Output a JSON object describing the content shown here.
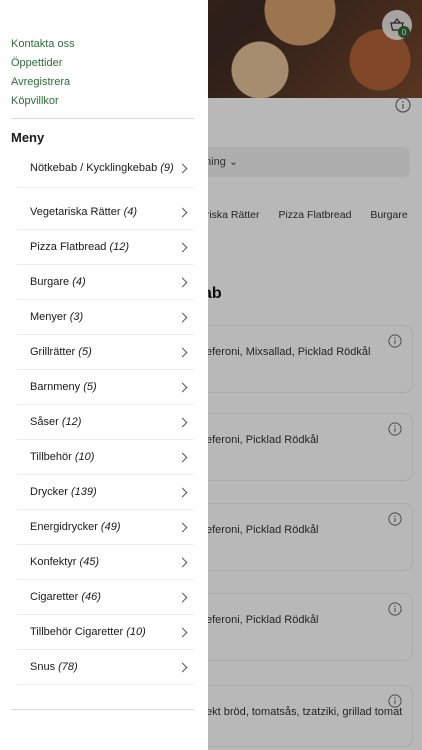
{
  "drawer": {
    "links": [
      "Kontakta oss",
      "Öppettider",
      "Avregistrera",
      "Köpvillkor"
    ],
    "menu_title": "Meny",
    "menu_items": [
      {
        "name": "Nötkebab / Kycklingkebab",
        "count": "(9)"
      },
      {
        "name": "Vegetariska Rätter",
        "count": "(4)"
      },
      {
        "name": "Pizza Flatbread",
        "count": "(12)"
      },
      {
        "name": "Burgare",
        "count": "(4)"
      },
      {
        "name": "Menyer",
        "count": "(3)"
      },
      {
        "name": "Grillrätter",
        "count": "(5)"
      },
      {
        "name": "Barnmeny",
        "count": "(5)"
      },
      {
        "name": "Såser",
        "count": "(12)"
      },
      {
        "name": "Tillbehör",
        "count": "(10)"
      },
      {
        "name": "Drycker",
        "count": "(139)"
      },
      {
        "name": "Energidrycker",
        "count": "(49)"
      },
      {
        "name": "Konfektyr",
        "count": "(45)"
      },
      {
        "name": "Cigaretter",
        "count": "(46)"
      },
      {
        "name": "Tillbehör Cigaretter",
        "count": "(10)"
      },
      {
        "name": "Snus",
        "count": "(78)"
      }
    ]
  },
  "background": {
    "cart_count": "0",
    "sort_label": "tning",
    "categories": [
      "ariska Rätter",
      "Pizza Flatbread",
      "Burgare"
    ],
    "heading": "ab",
    "cards": [
      "eferoni, Mixsallad, Picklad Rödkål",
      "eferoni, Picklad Rödkål",
      "eferoni, Picklad Rödkål",
      "eferoni, Picklad Rödkål",
      "ekt bröd, tomatsås, tzatziki, grillad tomat"
    ]
  },
  "colors": {
    "accent": "#2f6b3a",
    "overlay": "rgba(0,0,0,0.28)"
  }
}
